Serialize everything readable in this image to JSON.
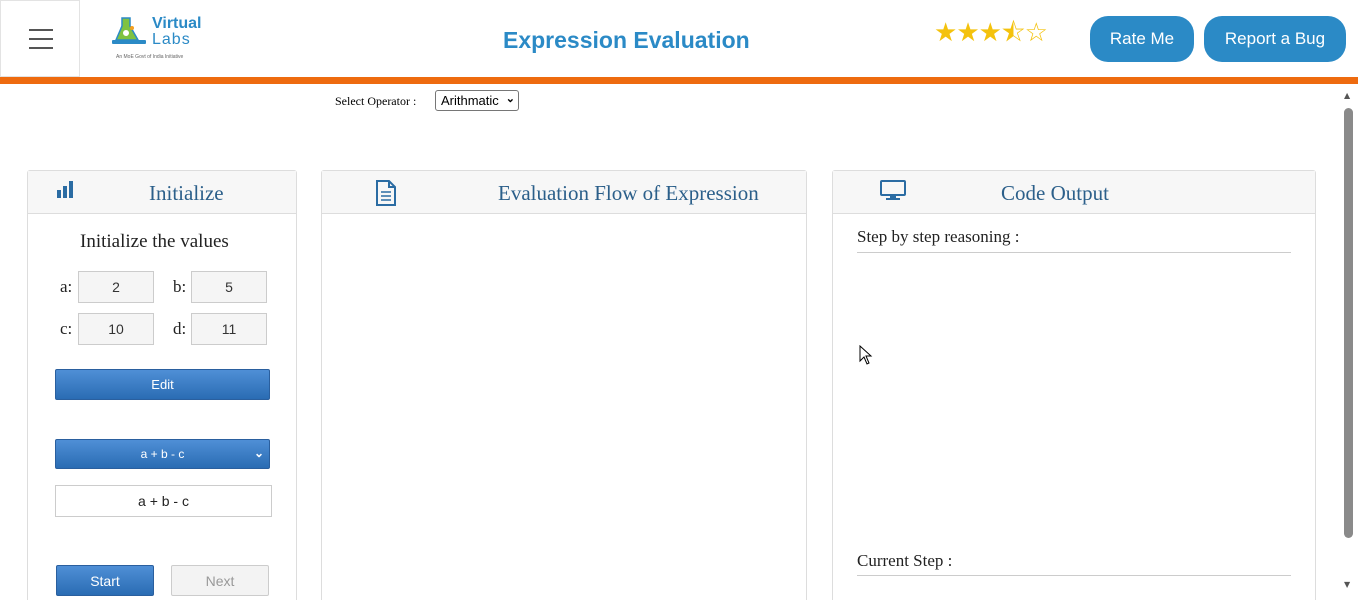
{
  "header": {
    "logo": {
      "line1": "Virtual",
      "line2": "Labs",
      "tagline": "An MoE Govt of India Initiative"
    },
    "title": "Expression Evaluation",
    "rating": {
      "value": 3.5,
      "max": 5
    },
    "rate_label": "Rate Me",
    "bug_label": "Report a Bug",
    "accent_color": "#2b8ac6",
    "bar_color": "#ee6b0f"
  },
  "operator": {
    "label": "Select Operator :",
    "selected": "Arithmatic"
  },
  "initialize": {
    "title": "Initialize",
    "subtitle": "Initialize the values",
    "vars": [
      {
        "name": "a:",
        "value": "2"
      },
      {
        "name": "b:",
        "value": "5"
      },
      {
        "name": "c:",
        "value": "10"
      },
      {
        "name": "d:",
        "value": "11"
      }
    ],
    "edit_label": "Edit",
    "expression_selected": "a + b - c",
    "expression_text": "a + b - c",
    "start_label": "Start",
    "next_label": "Next"
  },
  "flow": {
    "title": "Evaluation Flow of Expression"
  },
  "output": {
    "title": "Code Output",
    "reasoning_label": "Step by step reasoning :",
    "current_label": "Current Step :"
  }
}
